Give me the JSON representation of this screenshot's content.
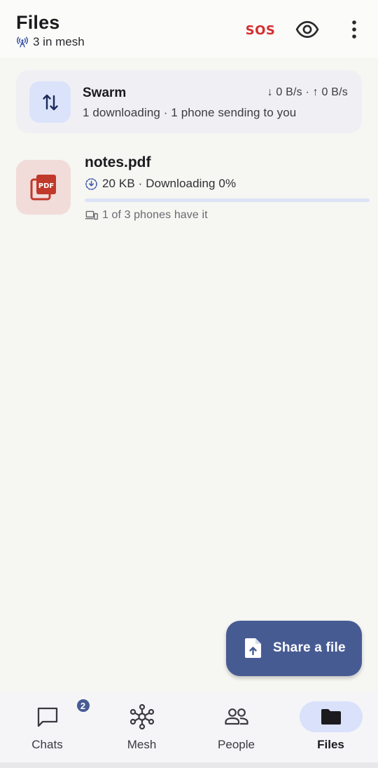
{
  "appbar": {
    "title": "Files",
    "mesh_status": "3 in mesh",
    "sos_label": "SOS"
  },
  "swarm": {
    "title": "Swarm",
    "speeds": "↓ 0 B/s · ↑ 0 B/s",
    "description": "1 downloading · 1 phone sending to you"
  },
  "files": [
    {
      "name": "notes.pdf",
      "status": "20 KB · Downloading 0%",
      "progress_percent": 0,
      "availability": "1 of 3 phones have it"
    }
  ],
  "fab": {
    "label": "Share a file"
  },
  "nav": {
    "items": [
      {
        "label": "Chats",
        "badge": "2",
        "icon": "chat-icon"
      },
      {
        "label": "Mesh",
        "icon": "mesh-icon"
      },
      {
        "label": "People",
        "icon": "people-icon"
      },
      {
        "label": "Files",
        "icon": "folder-icon",
        "active": true
      }
    ]
  },
  "colors": {
    "accent": "#475b93",
    "sos": "#d32f2f",
    "pdf": "#c0392b",
    "active_nav_bg": "#d9e1fb"
  }
}
